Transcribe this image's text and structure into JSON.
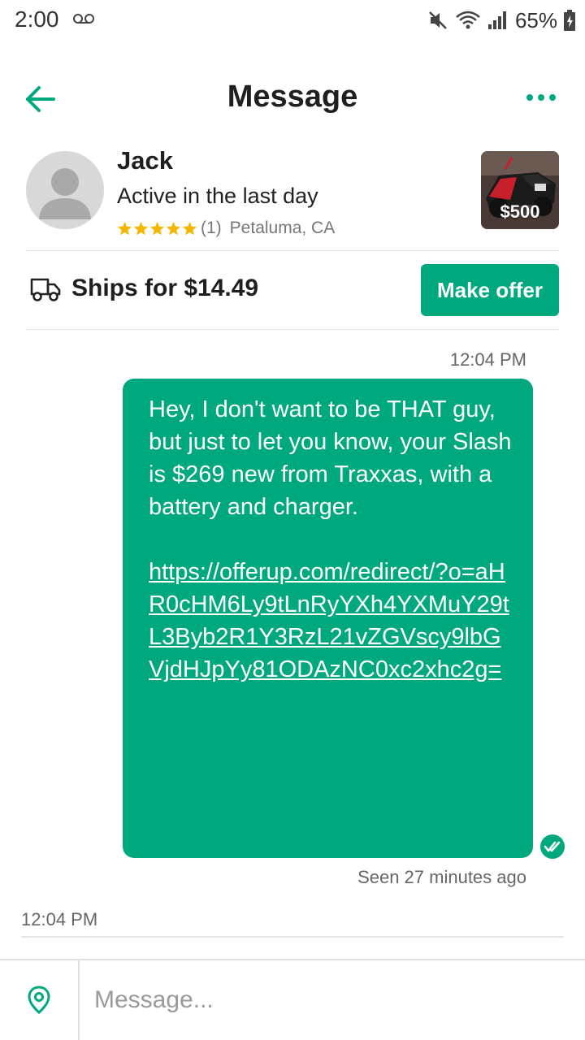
{
  "status_bar": {
    "time": "2:00",
    "battery": "65%"
  },
  "header": {
    "title": "Message",
    "back_icon": "arrow-left-icon",
    "more_icon": "more-horizontal-icon"
  },
  "seller": {
    "name": "Jack",
    "activity": "Active in the last day",
    "rating": 5,
    "rating_count": "(1)",
    "location": "Petaluma, CA"
  },
  "item": {
    "price": "$500"
  },
  "shipping": {
    "label": "Ships for $14.49",
    "offer_button": "Make offer"
  },
  "messages": [
    {
      "timestamp": "12:04 PM",
      "text": "Hey, I don't want to be THAT guy, but just to let you know, your Slash is $269 new from Traxxas, with a battery and charger.",
      "link": "https://offerup.com/redirect/?o=aHR0cHM6Ly9tLnRyYXh4YXMuY29tL3Byb2R1Y3RzL21vZGVscy9lbGVjdHJpYy81ODAzNC0xc2xhc2g=",
      "status": "Seen 27 minutes ago"
    },
    {
      "timestamp": "12:04 PM"
    }
  ],
  "composer": {
    "placeholder": "Message..."
  },
  "colors": {
    "brand": "#00a87e",
    "star": "#f5b800"
  }
}
